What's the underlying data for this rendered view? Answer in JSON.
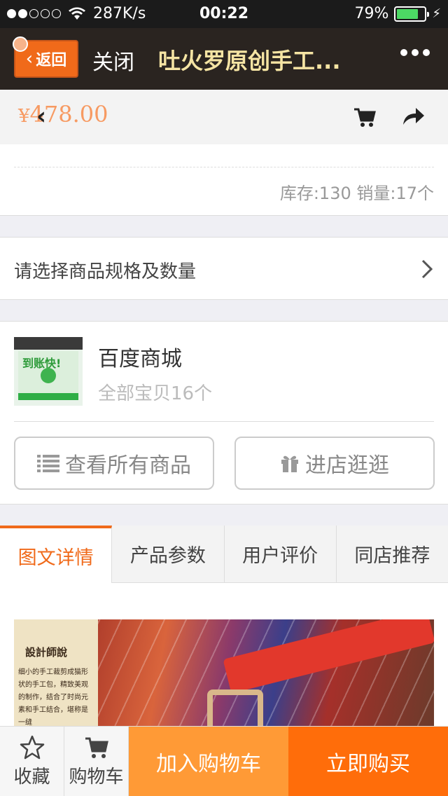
{
  "status": {
    "speed": "287K/s",
    "time": "00:22",
    "battery": "79%",
    "battery_level": 0.79
  },
  "nav": {
    "back_label": "返回",
    "close_label": "关闭",
    "title": "吐火罗原创手工..."
  },
  "product": {
    "currency": "¥",
    "price": "478.00",
    "stock": "库存:130 销量:17个"
  },
  "spec": {
    "label": "请选择商品规格及数量"
  },
  "store": {
    "name": "百度商城",
    "count": "全部宝贝16个",
    "all_label": "查看所有商品",
    "shop_label": "进店逛逛",
    "thumb_text": "到账快!"
  },
  "tabs": [
    "图文详情",
    "产品参数",
    "用户评价",
    "同店推荐"
  ],
  "content": {
    "note_title": "設計師說",
    "note_body": "细小的手工裁剪成猫形状的手工包，精致美观的制作，结合了时尚元素和手工结合，堪称是一缝"
  },
  "bottom": {
    "fav_label": "收藏",
    "cart_label": "购物车",
    "add_label": "加入购物车",
    "buy_label": "立即购买"
  },
  "colors": {
    "accent": "#f06a1a",
    "add": "#ff9a36",
    "buy": "#ff6d0a",
    "price": "#f79a62"
  }
}
